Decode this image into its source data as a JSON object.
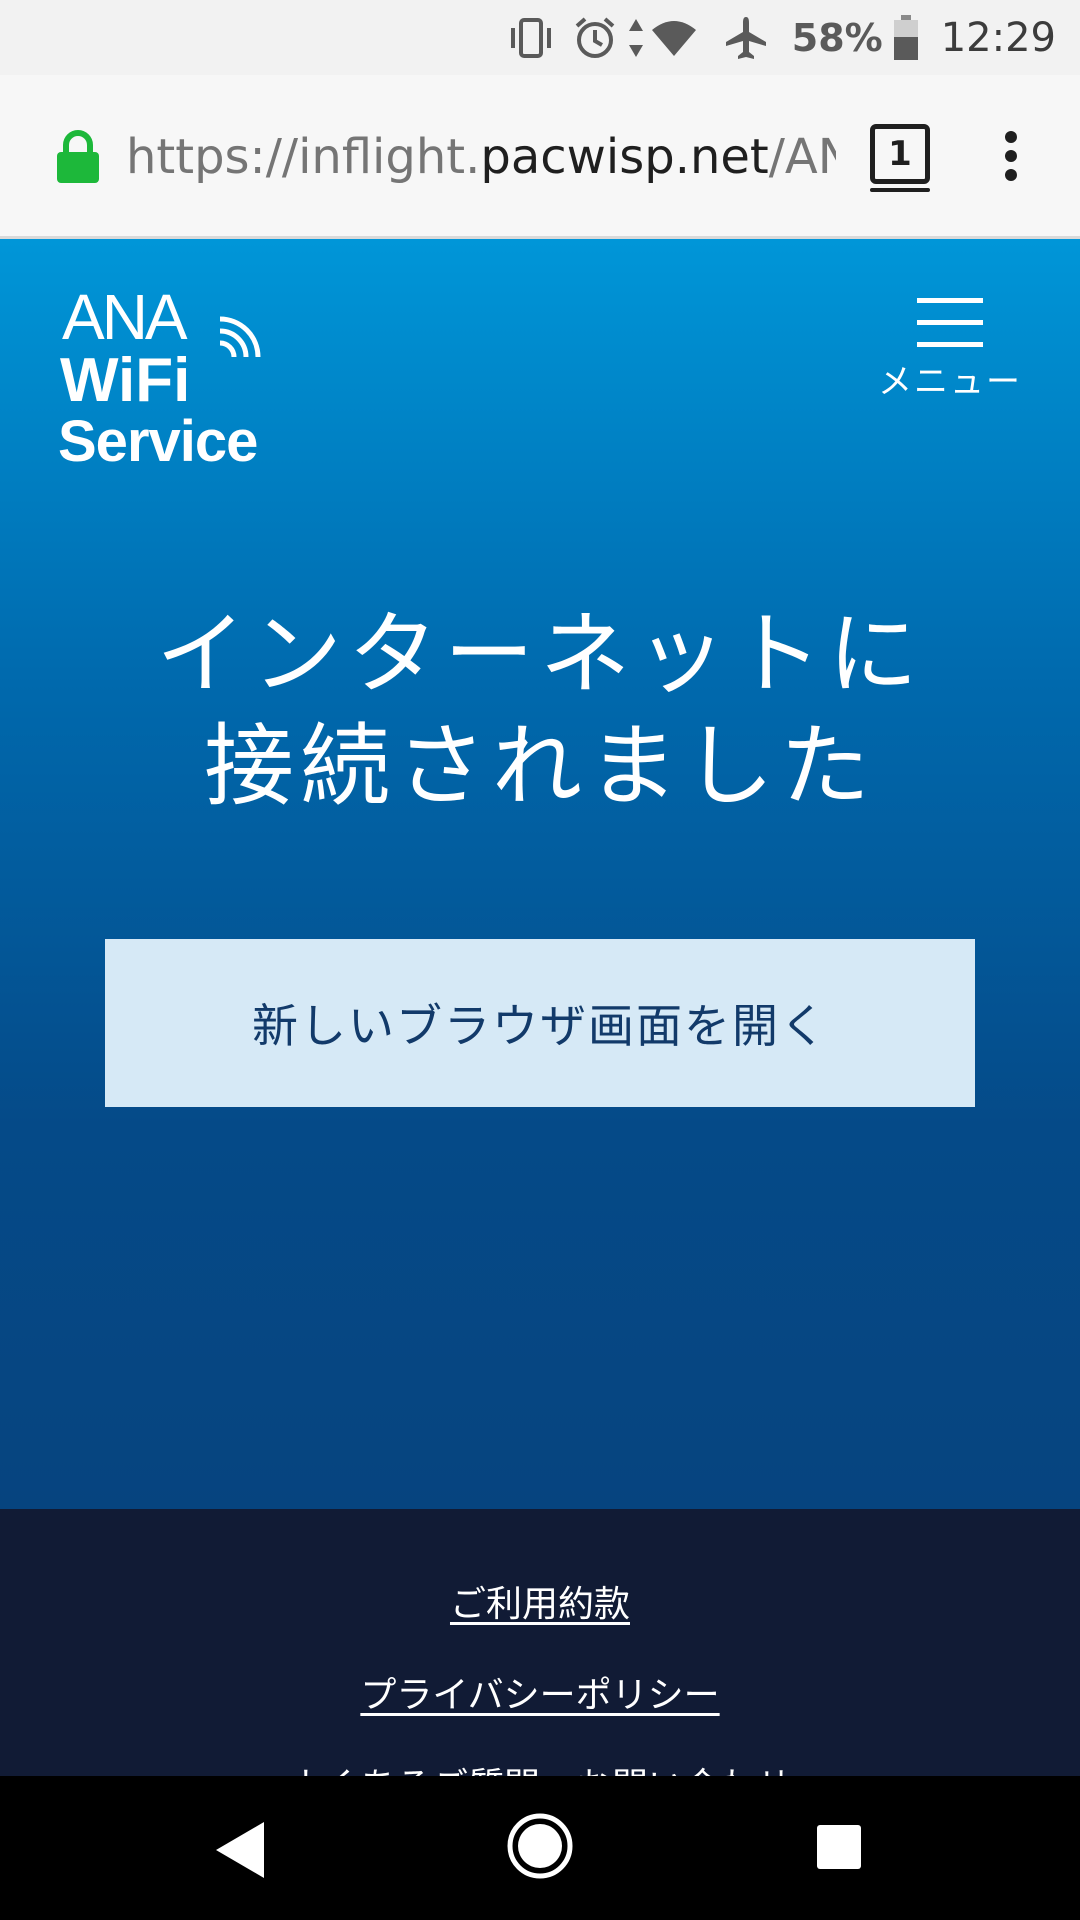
{
  "status_bar": {
    "battery_percent": "58%",
    "time": "12:29",
    "icons": [
      "vibrate-icon",
      "alarm-icon",
      "data-arrows-icon",
      "wifi-icon",
      "airplane-icon",
      "battery-icon"
    ]
  },
  "browser": {
    "url_scheme": "https://",
    "url_subdomain": "inflight.",
    "url_host": "pacwisp.net",
    "url_path": "/ANA/",
    "tab_count": "1"
  },
  "page": {
    "logo_text": "ANA WiFi Service",
    "menu_label": "メニュー",
    "headline_line1": "インターネットに",
    "headline_line2": "接続されました",
    "open_browser_label": "新しいブラウザ画面を開く"
  },
  "footer": {
    "links": [
      {
        "label": "ご利用約款"
      },
      {
        "label": "プライバシーポリシー"
      },
      {
        "label": "よくあるご質問・お問い合わせ"
      }
    ]
  },
  "colors": {
    "hero_top": "#0096d8",
    "hero_bottom": "#06447f",
    "button_bg": "#d6e9f6",
    "footer_bg": "#111b35",
    "lock_green": "#1db83a"
  }
}
